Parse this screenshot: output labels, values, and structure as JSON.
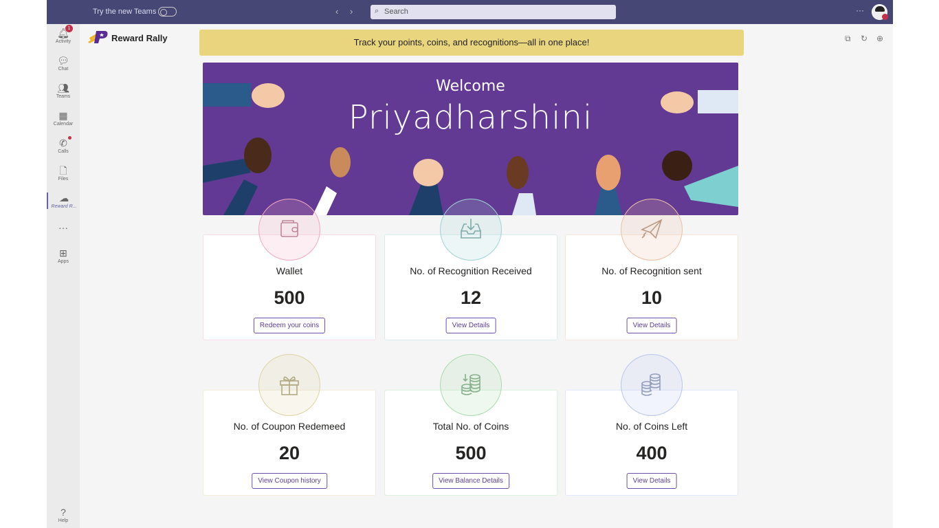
{
  "topbar": {
    "try_label": "Try the new Teams",
    "search_placeholder": "Search",
    "more": "···"
  },
  "rail": [
    {
      "label": "Activity",
      "icon": "bell-icon",
      "glyph": "🔔︎",
      "badge": "1"
    },
    {
      "label": "Chat",
      "icon": "chat-icon",
      "glyph": "💬︎"
    },
    {
      "label": "Teams",
      "icon": "teams-icon",
      "glyph": "👥︎"
    },
    {
      "label": "Calendar",
      "icon": "calendar-icon",
      "glyph": "▦"
    },
    {
      "label": "Calls",
      "icon": "phone-icon",
      "glyph": "✆"
    },
    {
      "label": "Files",
      "icon": "file-icon",
      "glyph": "🗋"
    },
    {
      "label": "Reward R...",
      "icon": "app-icon",
      "glyph": "☁"
    },
    {
      "label": "",
      "icon": "more-icon",
      "glyph": "···"
    },
    {
      "label": "Apps",
      "icon": "apps-icon",
      "glyph": "⊞"
    },
    {
      "label": "Help",
      "icon": "help-icon",
      "glyph": "?"
    }
  ],
  "app": {
    "title": "Reward Rally",
    "notice": "Track your points, coins, and recognitions—all in one place!"
  },
  "banner": {
    "welcome": "Welcome",
    "name": "Priyadharshini"
  },
  "cards": [
    {
      "title": "Wallet",
      "value": "500",
      "button": "Redeem your coins",
      "icon": "wallet-icon",
      "color": "#f0a8c0"
    },
    {
      "title": "No. of Recognition Received",
      "value": "12",
      "button": "View Details",
      "icon": "inbox-icon",
      "color": "#9fd3d6"
    },
    {
      "title": "No. of Recognition sent",
      "value": "10",
      "button": "View Details",
      "icon": "paper-plane-icon",
      "color": "#ecc0a4"
    },
    {
      "title": "No. of Coupon Redemeed",
      "value": "20",
      "button": "View Coupon history",
      "icon": "gift-icon",
      "color": "#ded3a4"
    },
    {
      "title": "Total No. of Coins",
      "value": "500",
      "button": "View Balance Details",
      "icon": "coins-icon",
      "color": "#a9dcae"
    },
    {
      "title": "No. of Coins Left",
      "value": "400",
      "button": "View Details",
      "icon": "coin-stack-icon",
      "color": "#b9c6ee"
    }
  ]
}
